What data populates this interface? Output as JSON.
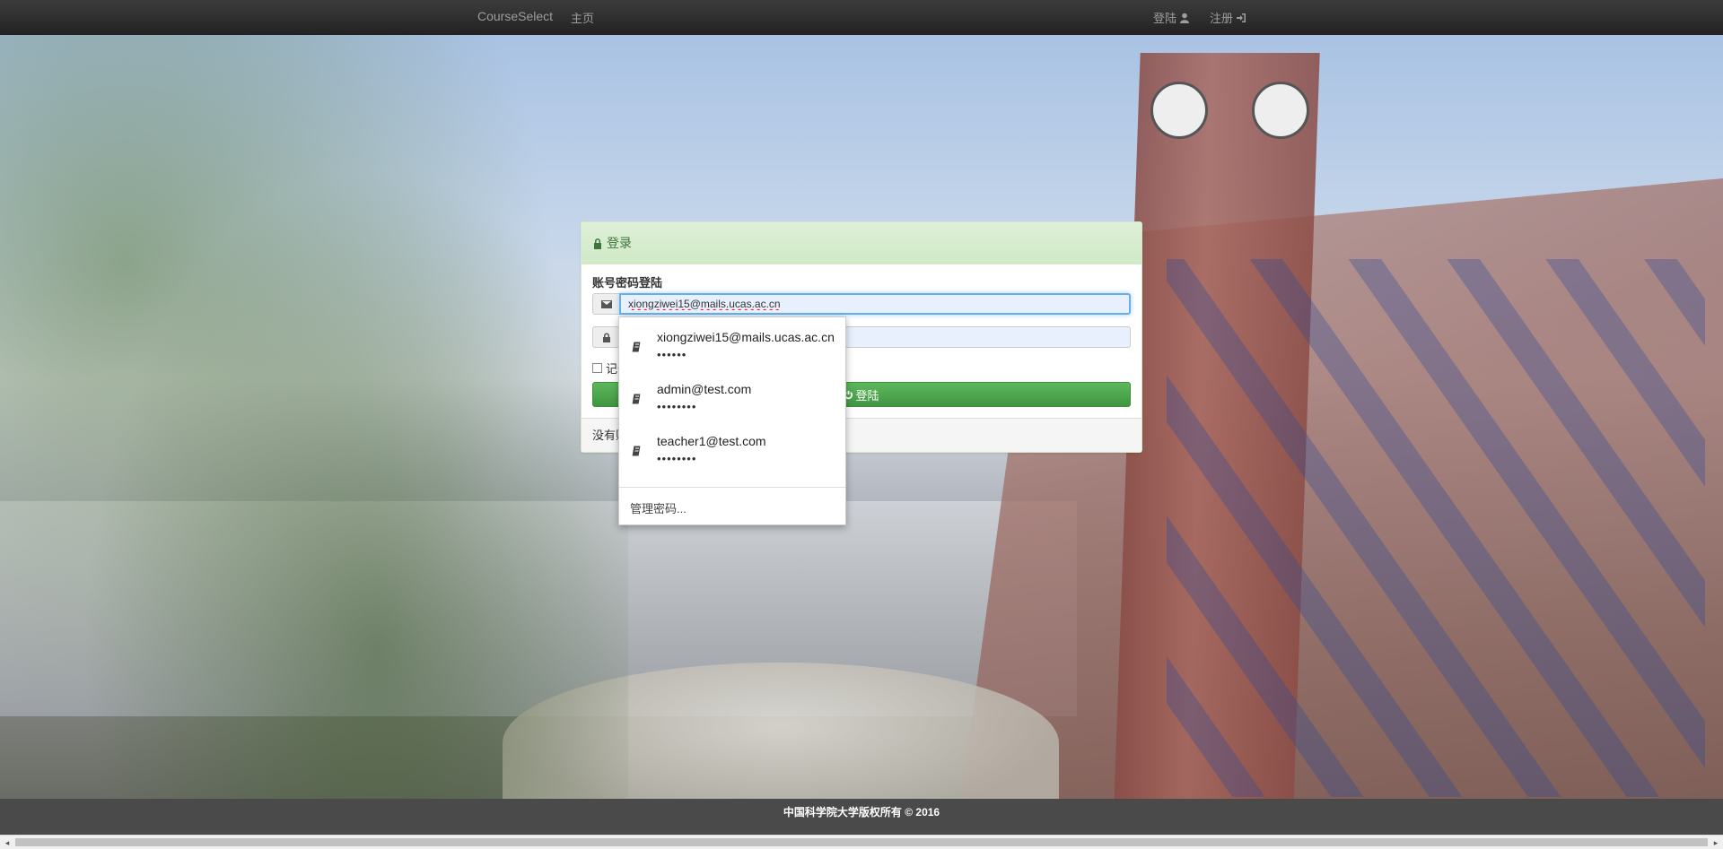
{
  "navbar": {
    "brand": "CourseSelect",
    "home": "主页",
    "login": "登陆",
    "register": "注册"
  },
  "panel": {
    "heading": "登录",
    "form_title": "账号密码登陆",
    "email_value": "xiongziwei15@mails.ucas.ac.cn",
    "remember_label": "记住",
    "login_button": "登陆",
    "footer_text": "没有账号?"
  },
  "autofill": {
    "items": [
      {
        "email": "xiongziwei15@mails.ucas.ac.cn",
        "password_mask": "••••••"
      },
      {
        "email": "admin@test.com",
        "password_mask": "••••••••"
      },
      {
        "email": "teacher1@test.com",
        "password_mask": "••••••••"
      }
    ],
    "manage": "管理密码..."
  },
  "footer": {
    "copyright": "中国科学院大学版权所有 © 2016"
  },
  "colors": {
    "panel_heading": "#dff0d8",
    "button": "#5cb85c",
    "navbar": "#222222"
  }
}
